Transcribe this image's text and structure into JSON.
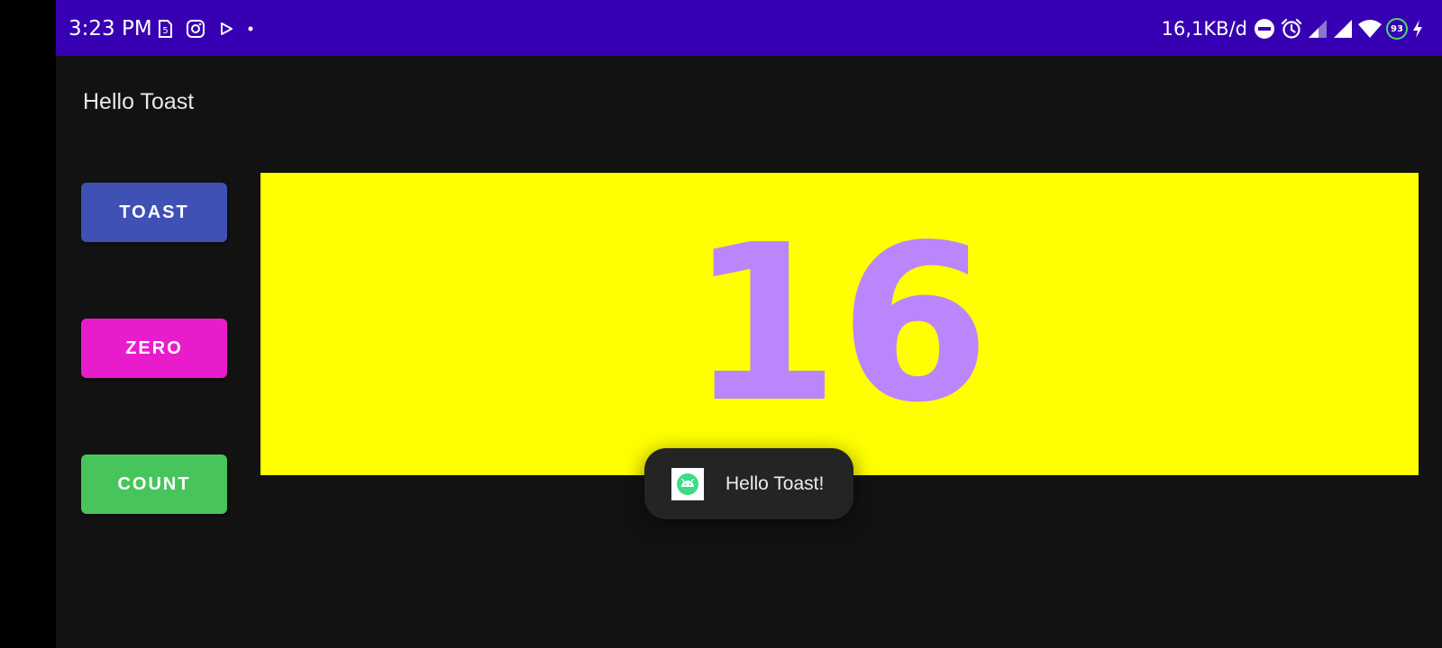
{
  "status_bar": {
    "time": "3:23 PM",
    "network_speed": "16,1KB/d",
    "battery_level": "93",
    "background_color": "#3700b3",
    "left_icons": [
      "sim-icon",
      "instagram-icon",
      "play-store-icon",
      "dot-icon"
    ],
    "right_icons": [
      "do-not-disturb-icon",
      "alarm-icon",
      "signal-icon",
      "signal-icon",
      "wifi-icon",
      "battery-icon",
      "charging-icon"
    ]
  },
  "app_bar": {
    "title": "Hello Toast"
  },
  "buttons": {
    "toast_label": "TOAST",
    "zero_label": "ZERO",
    "count_label": "COUNT"
  },
  "counter": {
    "value": "16",
    "panel_color": "#ffff00",
    "text_color": "#bb86fc"
  },
  "toast": {
    "message": "Hello Toast!",
    "icon": "android-app-icon"
  },
  "colors": {
    "toast_button": "#3f51b5",
    "zero_button": "#e91ccc",
    "count_button": "#47c45c",
    "app_background": "#121212"
  }
}
